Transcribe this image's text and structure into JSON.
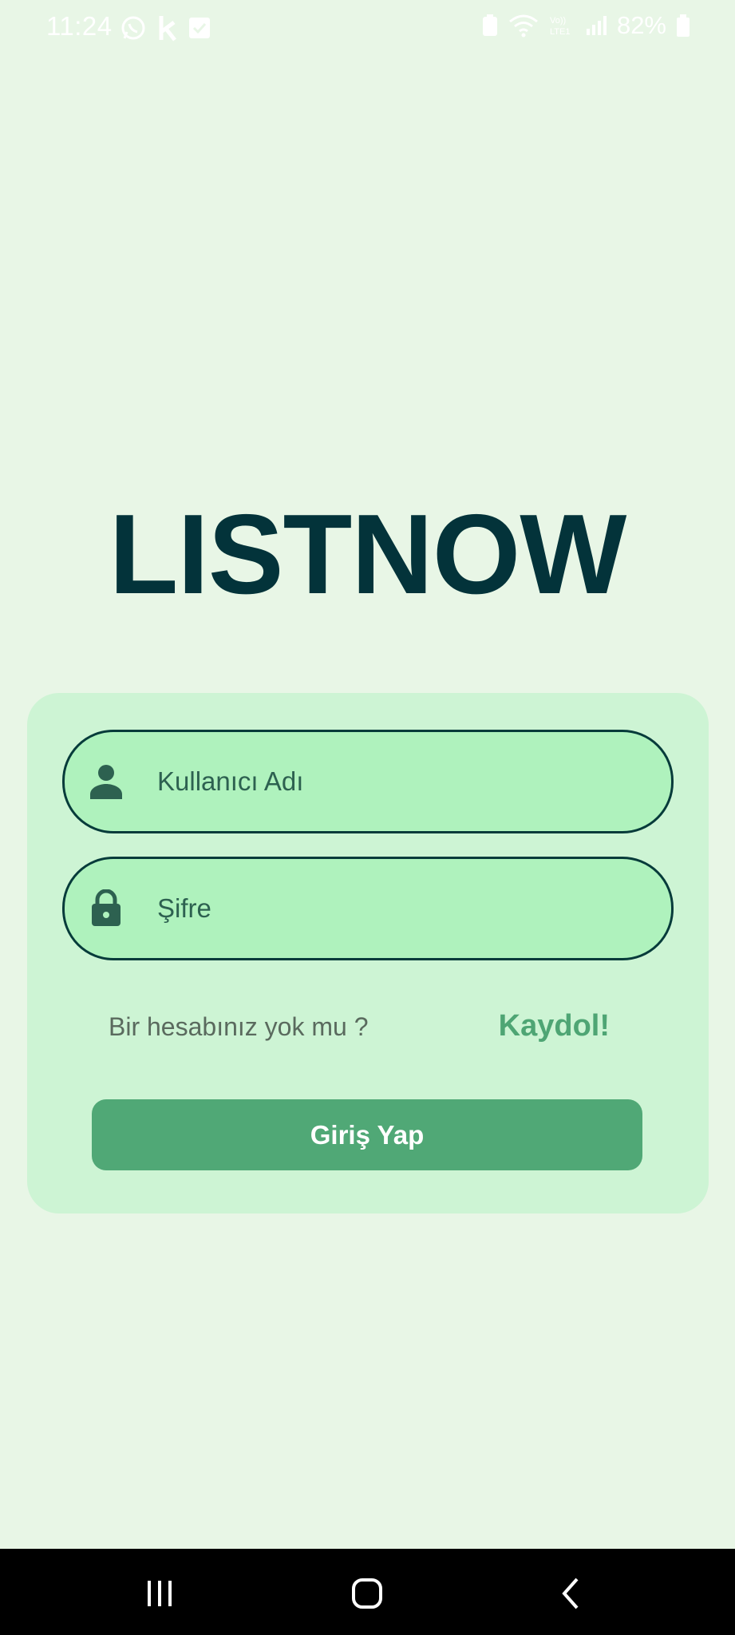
{
  "status_bar": {
    "time": "11:24",
    "battery_percent": "82%",
    "icons": [
      "whatsapp-icon",
      "k-app-icon",
      "check-box-icon",
      "battery-saver-icon",
      "wifi-icon",
      "volte-icon",
      "signal-icon",
      "battery-icon"
    ],
    "network_label": "Vo)) LTE1"
  },
  "app": {
    "logo": "LISTNOW"
  },
  "login_form": {
    "username_placeholder": "Kullanıcı Adı",
    "password_placeholder": "Şifre",
    "signup_prompt": "Bir hesabınız yok mu ?",
    "signup_link": "Kaydol!",
    "login_button": "Giriş Yap"
  },
  "colors": {
    "background": "#e8f6e6",
    "card": "#cdf4d4",
    "field": "#aff2bd",
    "primary_dark": "#03333a",
    "accent": "#50a876"
  },
  "nav_bar": {
    "icons": [
      "recent-apps-icon",
      "home-icon",
      "back-icon"
    ]
  }
}
